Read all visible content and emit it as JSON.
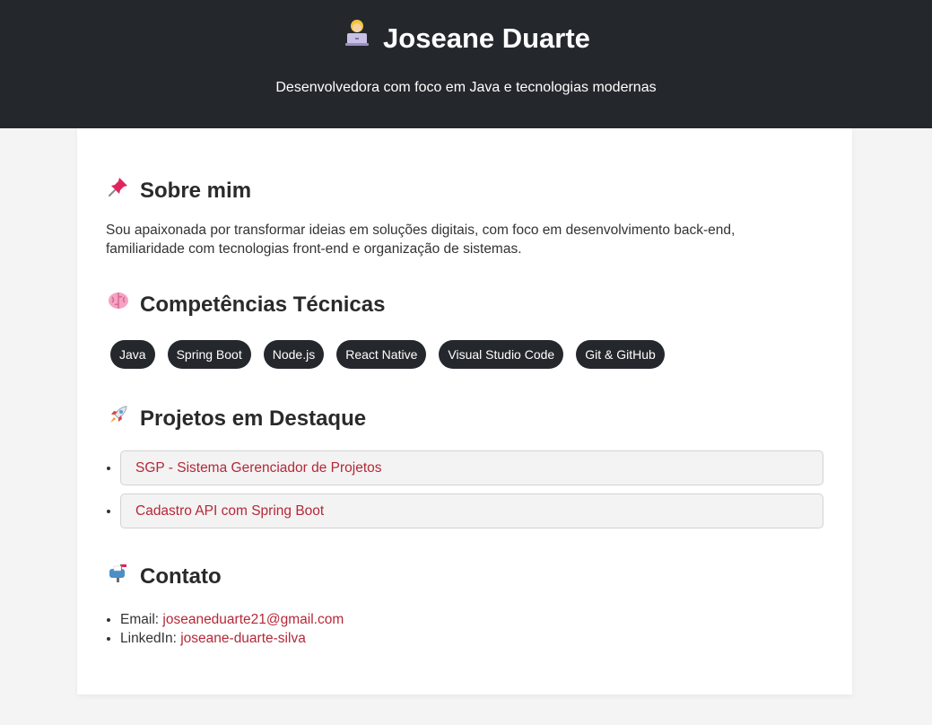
{
  "header": {
    "icon": "technologist-woman-icon",
    "title": "Joseane Duarte",
    "subtitle": "Desenvolvedora com foco em Java e tecnologias modernas"
  },
  "about": {
    "icon": "pushpin-icon",
    "heading": "Sobre mim",
    "text": "Sou apaixonada por transformar ideias em soluções digitais, com foco em desenvolvimento back-end, familiaridade com tecnologias front-end e organização de sistemas."
  },
  "skills": {
    "icon": "brain-icon",
    "heading": "Competências Técnicas",
    "items": [
      "Java",
      "Spring Boot",
      "Node.js",
      "React Native",
      "Visual Studio Code",
      "Git & GitHub"
    ]
  },
  "projects": {
    "icon": "rocket-icon",
    "heading": "Projetos em Destaque",
    "items": [
      {
        "label": "SGP - Sistema Gerenciador de Projetos"
      },
      {
        "label": "Cadastro API com Spring Boot"
      }
    ]
  },
  "contact": {
    "icon": "mailbox-icon",
    "heading": "Contato",
    "email_label": "Email:",
    "email": "joseaneduarte21@gmail.com",
    "linkedin_label": "LinkedIn:",
    "linkedin": "joseane-duarte-silva"
  },
  "colors": {
    "header_bg": "#24282d",
    "page_bg": "#f4f4f4",
    "link": "#b52838",
    "badge_bg": "#24282d"
  }
}
